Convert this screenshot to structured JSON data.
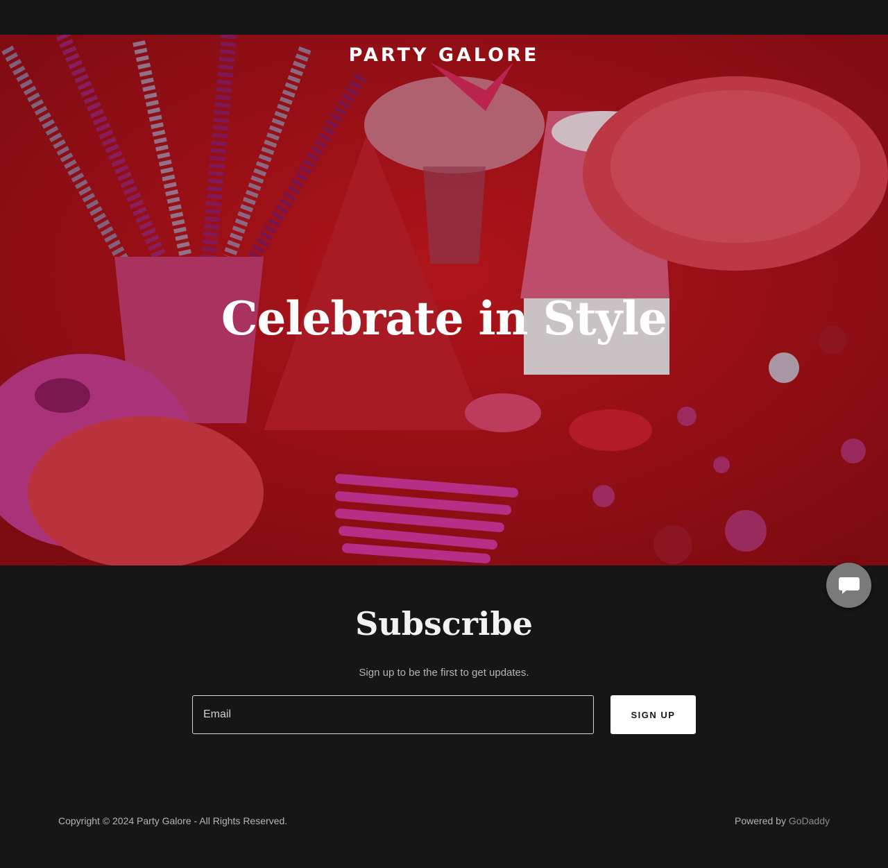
{
  "header": {
    "brand": "PARTY GALORE"
  },
  "hero": {
    "title": "Celebrate in Style"
  },
  "subscribe": {
    "title": "Subscribe",
    "text": "Sign up to be the first to get updates.",
    "email_placeholder": "Email",
    "button_label": "SIGN UP"
  },
  "footer": {
    "copyright": "Copyright © 2024 Party Galore - All Rights Reserved.",
    "powered_by": "Powered by",
    "powered_link": "GoDaddy"
  },
  "icons": {
    "chat": "chat-bubble-icon"
  },
  "colors": {
    "page_bg": "#161616",
    "hero_red": "#b3121c",
    "button_bg": "#ffffff"
  }
}
